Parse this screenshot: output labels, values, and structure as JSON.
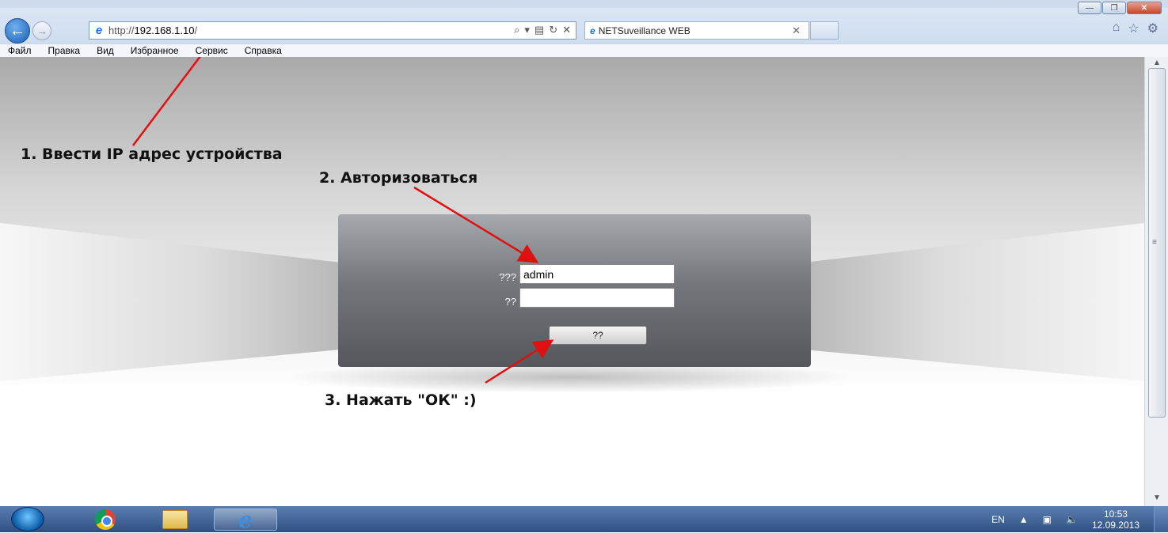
{
  "browser": {
    "url_prefix": "http://",
    "url_host": "192.168.1.10",
    "url_suffix": "/",
    "tab_title": "NETSuveillance WEB",
    "addr_tools": [
      "⌕",
      "▾",
      "▤",
      "↻",
      "✕"
    ],
    "right_icons": [
      "⌂",
      "☆",
      "⚙"
    ],
    "window_controls": [
      "—",
      "❐",
      "✕"
    ]
  },
  "menubar": {
    "items": [
      "Файл",
      "Правка",
      "Вид",
      "Избранное",
      "Сервис",
      "Справка"
    ]
  },
  "login": {
    "user_label": "???",
    "pass_label": "??",
    "user_value": "admin",
    "pass_value": "",
    "ok_label": "??"
  },
  "annotations": {
    "step1": "1. Ввести IP адрес устройства",
    "step2": "2. Авторизоваться",
    "step3": "3. Нажать \"ОК\" :)",
    "arrow_color": "#e01010"
  },
  "taskbar": {
    "lang": "EN",
    "time": "10:53",
    "date": "12.09.2013"
  }
}
